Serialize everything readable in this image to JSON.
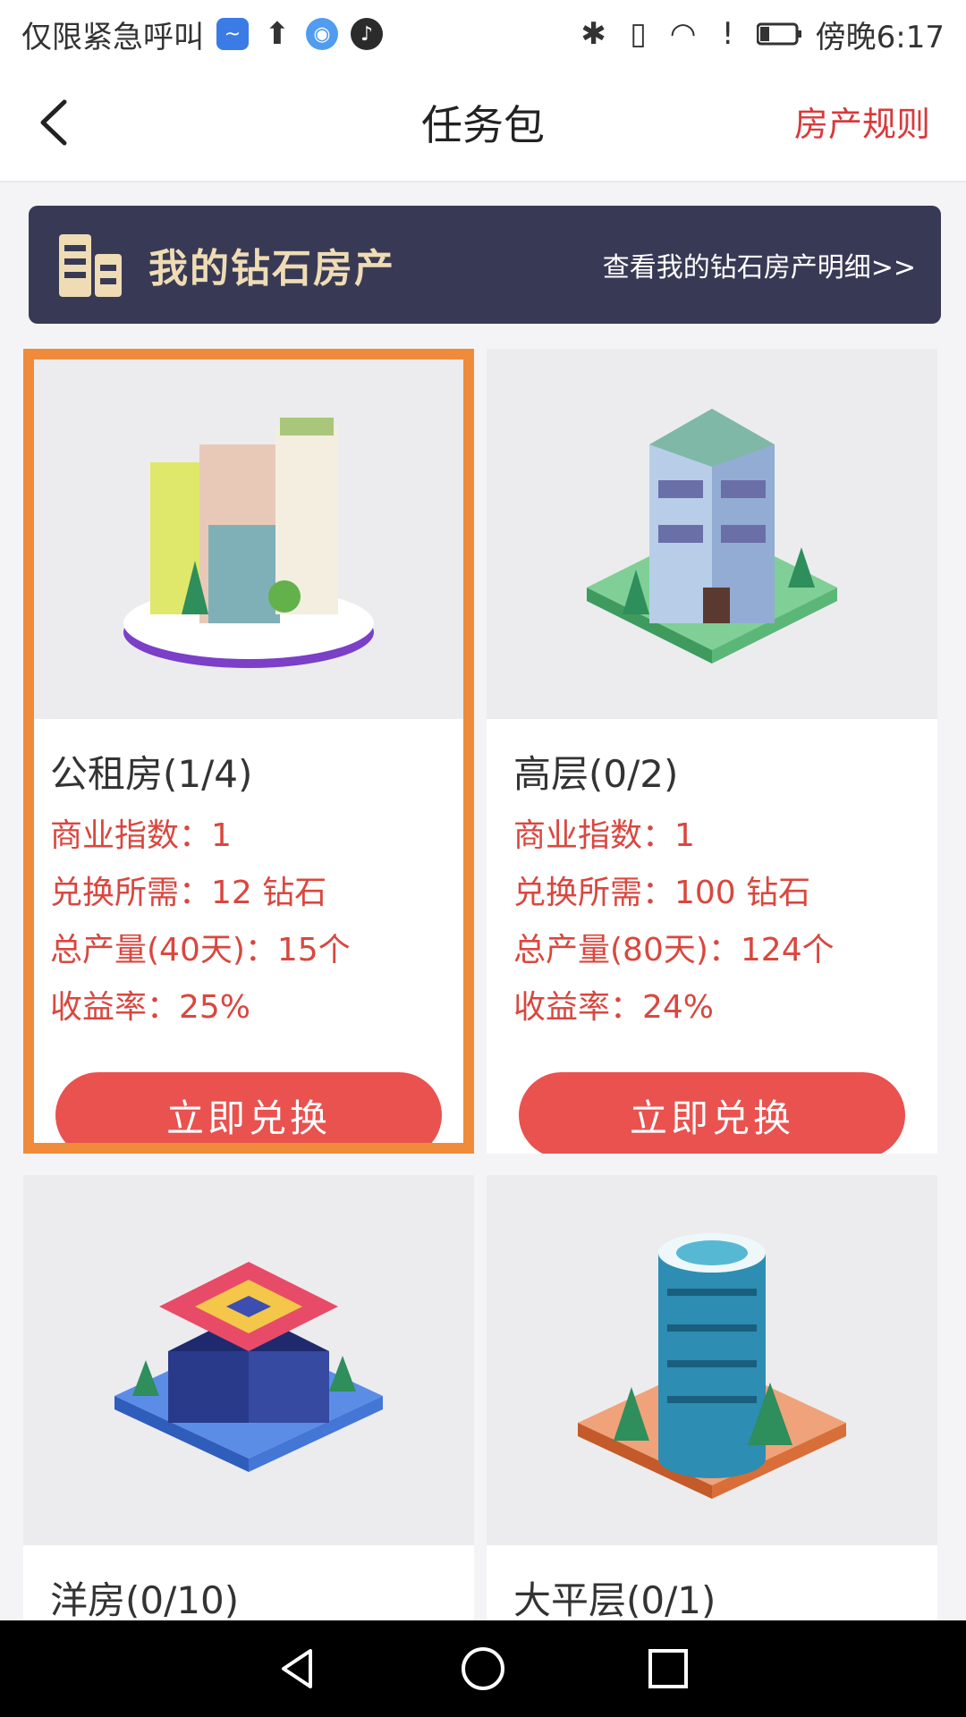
{
  "status_bar": {
    "carrier_text": "仅限紧急呼叫",
    "time": "傍晚6:17",
    "left_icons": [
      "chart-app-icon",
      "upload-icon",
      "qq-app-icon",
      "tiktok-icon"
    ],
    "right_icons": [
      "bluetooth-icon",
      "vibrate-icon",
      "wifi-icon",
      "alert-icon",
      "battery-icon"
    ]
  },
  "header": {
    "title": "任务包",
    "rules_link": "房产规则"
  },
  "banner": {
    "title": "我的钻石房产",
    "link": "查看我的钻石房产明细>>"
  },
  "colors": {
    "accent_red": "#e9524f",
    "text_red": "#d9473f",
    "banner_bg": "#383a55",
    "selected_border": "#f08b3c"
  },
  "properties": [
    {
      "name": "公租房(1/4)",
      "business_index": "商业指数：1",
      "cost": "兑换所需：12 钻石",
      "total_output": "总产量(40天)：15个",
      "yield_rate": "收益率：25%",
      "button": "立即兑换",
      "selected": true
    },
    {
      "name": "高层(0/2)",
      "business_index": "商业指数：1",
      "cost": "兑换所需：100 钻石",
      "total_output": "总产量(80天)：124个",
      "yield_rate": "收益率：24%",
      "button": "立即兑换",
      "selected": false
    },
    {
      "name": "洋房(0/10)"
    },
    {
      "name": "大平层(0/1)"
    }
  ],
  "nav": {
    "buttons": [
      "back-triangle-icon",
      "home-circle-icon",
      "recents-square-icon"
    ]
  }
}
